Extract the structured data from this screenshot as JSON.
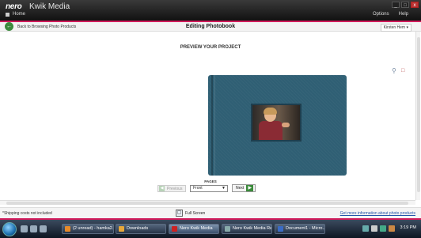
{
  "app": {
    "brand": "nero",
    "product": "Kwik Media",
    "home": "Home",
    "options": "Options",
    "help": "Help",
    "window_buttons": [
      "_",
      "□",
      "x"
    ]
  },
  "header": {
    "back_label": "Back to Browsing Photo Products",
    "title": "Editing Photobook",
    "user": "Kirsten Hem"
  },
  "preview": {
    "title": "PREVIEW YOUR PROJECT",
    "pages_label": "PAGES",
    "previous": "Previous",
    "page_select_value": "Front",
    "next": "Next"
  },
  "footer": {
    "shipping_note": "*Shipping costs not included",
    "full_screen": "Full Screen",
    "more_info": "Get more information about photo products"
  },
  "taskbar": {
    "tasks": [
      {
        "label": "(2 unread) - hamka2...",
        "color": "#e88a2a"
      },
      {
        "label": "Downloads",
        "color": "#e8a83a"
      },
      {
        "label": "Nero Kwik Media",
        "color": "#c22"
      },
      {
        "label": "Nero Kwik Media Re...",
        "color": "#8aa"
      },
      {
        "label": "Document1 - Micro...",
        "color": "#3a6bc4"
      }
    ],
    "clock": "3:19 PM"
  },
  "colors": {
    "accent": "#d01b5b",
    "book_cover": "#2f5f74",
    "next_arrow": "#3b8a3b"
  }
}
